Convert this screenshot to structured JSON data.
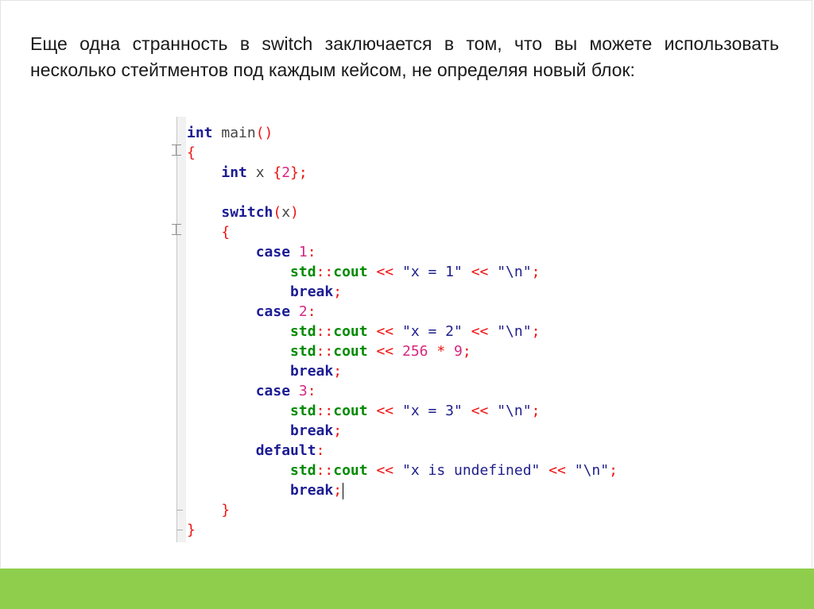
{
  "intro": {
    "text": "Еще одна странность в switch заключается в том, что вы можете использовать несколько стейтментов под каждым кейсом, не определяя новый блок:"
  },
  "code": {
    "lines": [
      [
        [
          "kw",
          "int"
        ],
        [
          "plain",
          " main"
        ],
        [
          "op",
          "()"
        ]
      ],
      [
        [
          "op",
          "{"
        ]
      ],
      [
        [
          "plain",
          "    "
        ],
        [
          "kw",
          "int"
        ],
        [
          "plain",
          " x "
        ],
        [
          "op",
          "{"
        ],
        [
          "num",
          "2"
        ],
        [
          "op",
          "};"
        ]
      ],
      [],
      [
        [
          "plain",
          "    "
        ],
        [
          "kw",
          "switch"
        ],
        [
          "op",
          "("
        ],
        [
          "plain",
          "x"
        ],
        [
          "op",
          ")"
        ]
      ],
      [
        [
          "plain",
          "    "
        ],
        [
          "op",
          "{"
        ]
      ],
      [
        [
          "plain",
          "        "
        ],
        [
          "kw",
          "case"
        ],
        [
          "plain",
          " "
        ],
        [
          "num",
          "1"
        ],
        [
          "op",
          ":"
        ]
      ],
      [
        [
          "plain",
          "            "
        ],
        [
          "ns",
          "std"
        ],
        [
          "op",
          "::"
        ],
        [
          "ns",
          "cout"
        ],
        [
          "plain",
          " "
        ],
        [
          "op",
          "<<"
        ],
        [
          "plain",
          " "
        ],
        [
          "str",
          "\"x = 1\""
        ],
        [
          "plain",
          " "
        ],
        [
          "op",
          "<<"
        ],
        [
          "plain",
          " "
        ],
        [
          "str",
          "\"\\n\""
        ],
        [
          "op",
          ";"
        ]
      ],
      [
        [
          "plain",
          "            "
        ],
        [
          "kw",
          "break"
        ],
        [
          "op",
          ";"
        ]
      ],
      [
        [
          "plain",
          "        "
        ],
        [
          "kw",
          "case"
        ],
        [
          "plain",
          " "
        ],
        [
          "num",
          "2"
        ],
        [
          "op",
          ":"
        ]
      ],
      [
        [
          "plain",
          "            "
        ],
        [
          "ns",
          "std"
        ],
        [
          "op",
          "::"
        ],
        [
          "ns",
          "cout"
        ],
        [
          "plain",
          " "
        ],
        [
          "op",
          "<<"
        ],
        [
          "plain",
          " "
        ],
        [
          "str",
          "\"x = 2\""
        ],
        [
          "plain",
          " "
        ],
        [
          "op",
          "<<"
        ],
        [
          "plain",
          " "
        ],
        [
          "str",
          "\"\\n\""
        ],
        [
          "op",
          ";"
        ]
      ],
      [
        [
          "plain",
          "            "
        ],
        [
          "ns",
          "std"
        ],
        [
          "op",
          "::"
        ],
        [
          "ns",
          "cout"
        ],
        [
          "plain",
          " "
        ],
        [
          "op",
          "<<"
        ],
        [
          "plain",
          " "
        ],
        [
          "num",
          "256"
        ],
        [
          "plain",
          " "
        ],
        [
          "op",
          "*"
        ],
        [
          "plain",
          " "
        ],
        [
          "num",
          "9"
        ],
        [
          "op",
          ";"
        ]
      ],
      [
        [
          "plain",
          "            "
        ],
        [
          "kw",
          "break"
        ],
        [
          "op",
          ";"
        ]
      ],
      [
        [
          "plain",
          "        "
        ],
        [
          "kw",
          "case"
        ],
        [
          "plain",
          " "
        ],
        [
          "num",
          "3"
        ],
        [
          "op",
          ":"
        ]
      ],
      [
        [
          "plain",
          "            "
        ],
        [
          "ns",
          "std"
        ],
        [
          "op",
          "::"
        ],
        [
          "ns",
          "cout"
        ],
        [
          "plain",
          " "
        ],
        [
          "op",
          "<<"
        ],
        [
          "plain",
          " "
        ],
        [
          "str",
          "\"x = 3\""
        ],
        [
          "plain",
          " "
        ],
        [
          "op",
          "<<"
        ],
        [
          "plain",
          " "
        ],
        [
          "str",
          "\"\\n\""
        ],
        [
          "op",
          ";"
        ]
      ],
      [
        [
          "plain",
          "            "
        ],
        [
          "kw",
          "break"
        ],
        [
          "op",
          ";"
        ]
      ],
      [
        [
          "plain",
          "        "
        ],
        [
          "kw",
          "default"
        ],
        [
          "op",
          ":"
        ]
      ],
      [
        [
          "plain",
          "            "
        ],
        [
          "ns",
          "std"
        ],
        [
          "op",
          "::"
        ],
        [
          "ns",
          "cout"
        ],
        [
          "plain",
          " "
        ],
        [
          "op",
          "<<"
        ],
        [
          "plain",
          " "
        ],
        [
          "str",
          "\"x is undefined\""
        ],
        [
          "plain",
          " "
        ],
        [
          "op",
          "<<"
        ],
        [
          "plain",
          " "
        ],
        [
          "str",
          "\"\\n\""
        ],
        [
          "op",
          ";"
        ]
      ],
      [
        [
          "plain",
          "            "
        ],
        [
          "kw",
          "break"
        ],
        [
          "op",
          ";"
        ],
        [
          "caret",
          ""
        ]
      ],
      [
        [
          "plain",
          "    "
        ],
        [
          "op",
          "}"
        ]
      ],
      [
        [
          "op",
          "}"
        ]
      ]
    ]
  },
  "colors": {
    "footer": "#8ece4c",
    "keyword": "#1c1c94",
    "namespace": "#008a00",
    "operator": "#ee1111",
    "string": "#1e1e8c",
    "number": "#d6287f"
  }
}
